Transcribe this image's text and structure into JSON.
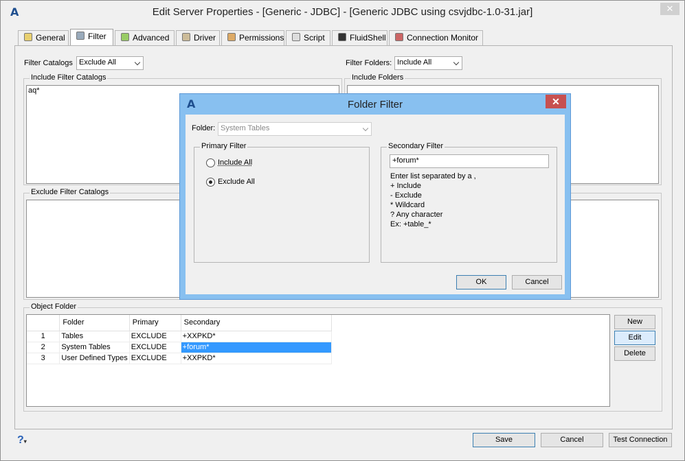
{
  "window": {
    "title": "Edit Server Properties - [Generic - JDBC] - [Generic JDBC using csvjdbc-1.0-31.jar]",
    "close": "✕"
  },
  "tabs": [
    {
      "label": "General",
      "icon": "general-icon"
    },
    {
      "label": "Filter",
      "icon": "filter-icon"
    },
    {
      "label": "Advanced",
      "icon": "advanced-icon"
    },
    {
      "label": "Driver",
      "icon": "driver-icon"
    },
    {
      "label": "Permissions",
      "icon": "permissions-icon"
    },
    {
      "label": "Script",
      "icon": "script-icon"
    },
    {
      "label": "FluidShell",
      "icon": "fluidshell-icon"
    },
    {
      "label": "Connection Monitor",
      "icon": "monitor-icon"
    }
  ],
  "filter": {
    "catalogs_label": "Filter Catalogs",
    "catalogs_value": "Exclude All",
    "folders_label": "Filter Folders:",
    "folders_value": "Include All",
    "include_catalogs_label": "Include Filter Catalogs",
    "include_catalogs_text": "aq*",
    "include_folders_label": "Include Folders",
    "exclude_catalogs_label": "Exclude Filter Catalogs"
  },
  "object_folder": {
    "label": "Object Folder",
    "columns": [
      "Folder",
      "Primary",
      "Secondary"
    ],
    "rows": [
      {
        "n": "1",
        "folder": "Tables",
        "primary": "EXCLUDE",
        "secondary": "+XXPKD*"
      },
      {
        "n": "2",
        "folder": "System Tables",
        "primary": "EXCLUDE",
        "secondary": "+forum*"
      },
      {
        "n": "3",
        "folder": "User Defined Types",
        "primary": "EXCLUDE",
        "secondary": "+XXPKD*"
      }
    ],
    "buttons": {
      "new": "New",
      "edit": "Edit",
      "delete": "Delete"
    }
  },
  "footer": {
    "help": "?",
    "save": "Save",
    "cancel": "Cancel",
    "test": "Test Connection"
  },
  "dialog": {
    "title": "Folder Filter",
    "close": "✕",
    "folder_label": "Folder:",
    "folder_value": "System Tables",
    "primary_label": "Primary Filter",
    "include_all": "Include All",
    "exclude_all": "Exclude All",
    "secondary_label": "Secondary Filter",
    "secondary_value": "+forum*",
    "help_lines": [
      "Enter list separated by a ,",
      "+ Include",
      "- Exclude",
      "* Wildcard",
      "? Any character",
      "Ex: +table_*"
    ],
    "ok": "OK",
    "cancel": "Cancel"
  },
  "colors": {
    "selection": "#3399ff",
    "dialog_frame": "#88c0f0",
    "dialog_close": "#c75050"
  }
}
